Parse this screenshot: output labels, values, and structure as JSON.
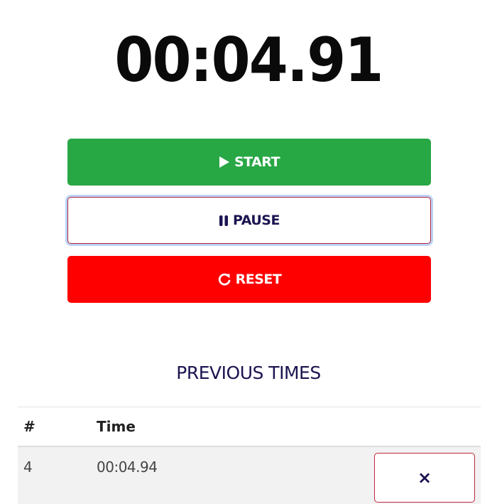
{
  "timer": {
    "display": "00:04.91"
  },
  "controls": {
    "start_label": "START",
    "pause_label": "PAUSE",
    "reset_label": "RESET",
    "start_icon": "play-icon",
    "pause_icon": "pause-icon",
    "reset_icon": "refresh-icon",
    "colors": {
      "start": "#28a745",
      "pause_text": "#1b1450",
      "reset": "#ff0000"
    }
  },
  "previous_times": {
    "title": "PREVIOUS TIMES",
    "columns": [
      "#",
      "Time"
    ],
    "rows": [
      {
        "index": "4",
        "time": "00:04.94",
        "delete_label": "×"
      }
    ]
  }
}
